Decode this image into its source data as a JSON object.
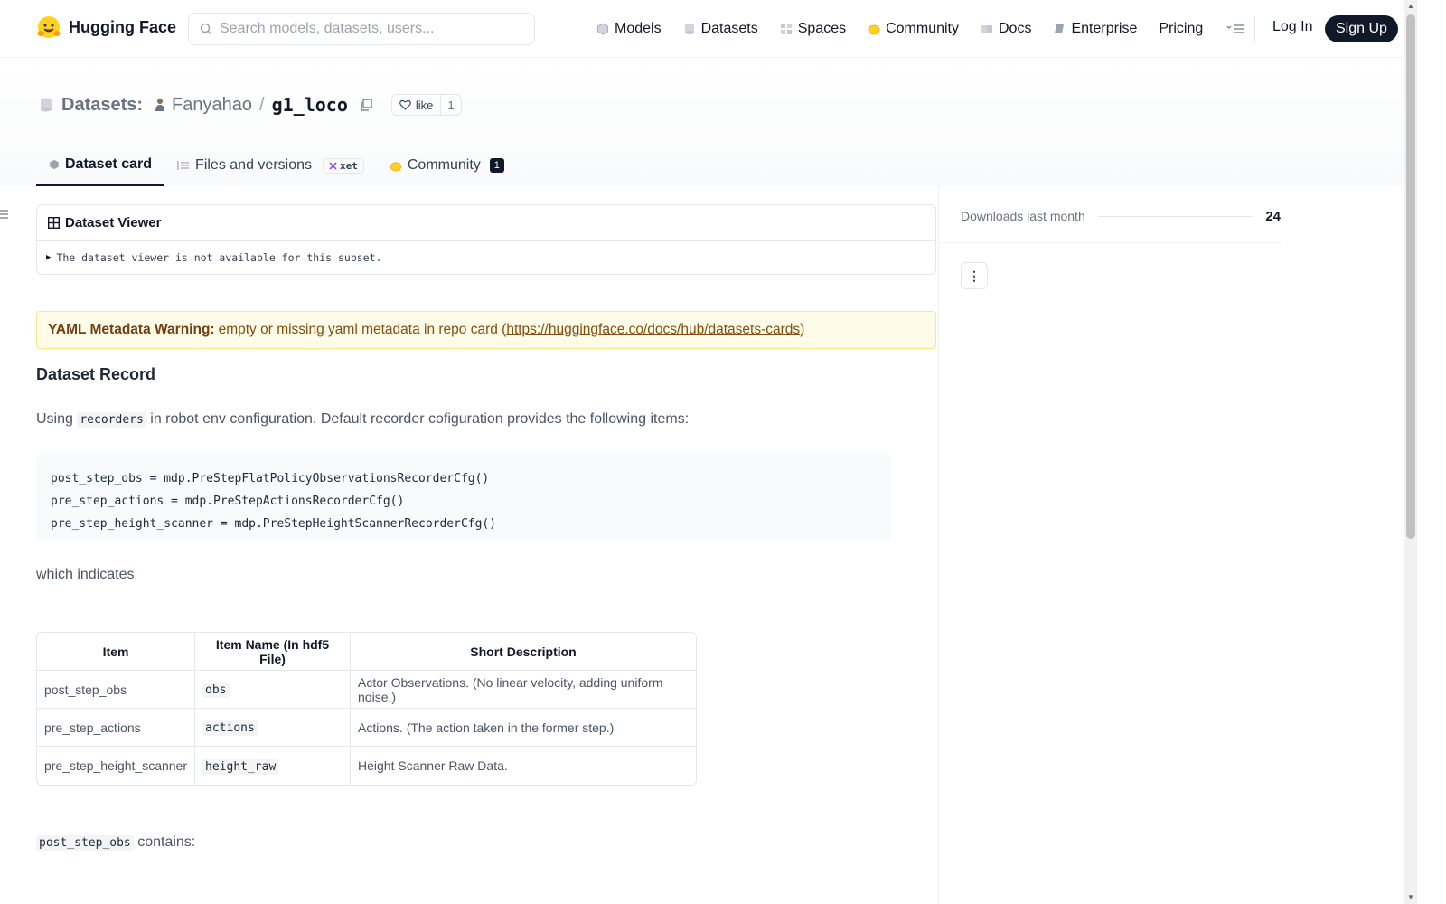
{
  "navbar": {
    "brand": "Hugging Face",
    "search_placeholder": "Search models, datasets, users...",
    "links": [
      {
        "label": "Models",
        "icon": "model-icon"
      },
      {
        "label": "Datasets",
        "icon": "dataset-icon"
      },
      {
        "label": "Spaces",
        "icon": "spaces-icon"
      },
      {
        "label": "Community",
        "icon": "community-icon"
      },
      {
        "label": "Docs",
        "icon": "docs-icon"
      },
      {
        "label": "Enterprise",
        "icon": "enterprise-icon"
      },
      {
        "label": "Pricing"
      }
    ],
    "login": "Log In",
    "signup": "Sign Up"
  },
  "header": {
    "type_label": "Datasets:",
    "user": "Fanyahao",
    "separator": "/",
    "repo": "g1_loco",
    "like_label": "like",
    "like_count": "1",
    "tabs": [
      {
        "label": "Dataset card",
        "active": true
      },
      {
        "label": "Files and versions",
        "badge": "xet"
      },
      {
        "label": "Community",
        "count": "1"
      }
    ]
  },
  "viewer": {
    "title": "Dataset Viewer",
    "message": "The dataset viewer is not available for this subset."
  },
  "warning": {
    "bold": "YAML Metadata Warning:",
    "text": " empty or missing yaml metadata in repo card (",
    "link": "https://huggingface.co/docs/hub/datasets-cards",
    "close": ")"
  },
  "content": {
    "heading": "Dataset Record",
    "intro_pre": "Using ",
    "intro_code": "recorders",
    "intro_post": " in robot env configuration. Default recorder cofiguration provides the following items:",
    "code_lines": [
      "post_step_obs = mdp.PreStepFlatPolicyObservationsRecorderCfg()",
      "pre_step_actions = mdp.PreStepActionsRecorderCfg()",
      "pre_step_height_scanner = mdp.PreStepHeightScannerRecorderCfg()"
    ],
    "indicates": "which indicates",
    "table": {
      "headers": [
        "Item",
        "Item Name (In hdf5 File)",
        "Short Description"
      ],
      "rows": [
        {
          "item": "post_step_obs",
          "name": "obs",
          "desc": "Actor Observations. (No linear velocity, adding uniform noise.)"
        },
        {
          "item": "pre_step_actions",
          "name": "actions",
          "desc": "Actions. (The action taken in the former step.)"
        },
        {
          "item": "pre_step_height_scanner",
          "name": "height_raw",
          "desc": "Height Scanner Raw Data."
        }
      ]
    },
    "contains_code": "post_step_obs",
    "contains_text": " contains:"
  },
  "sidebar": {
    "downloads_label": "Downloads last month",
    "downloads_value": "24"
  }
}
